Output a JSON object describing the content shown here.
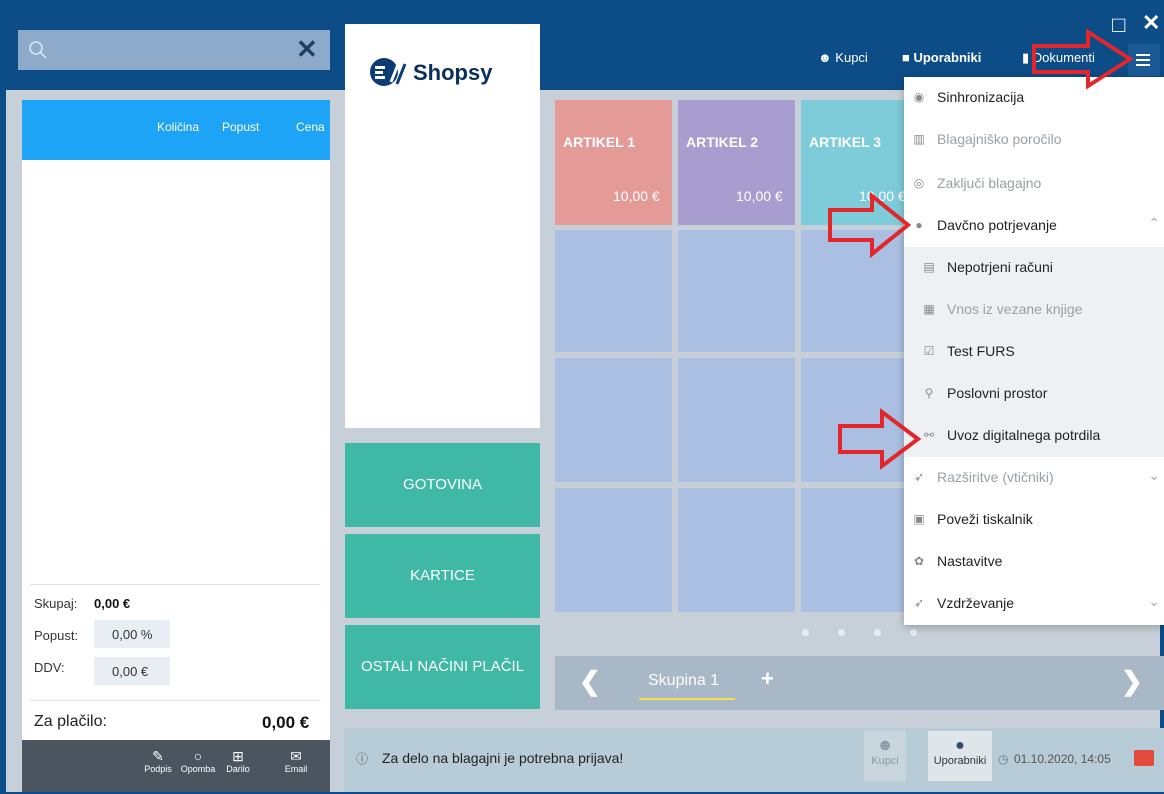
{
  "window": {
    "maximize_icon": "□",
    "close_icon": "✕"
  },
  "search": {
    "placeholder": "",
    "clear_icon": "✕"
  },
  "cart": {
    "col_qty": "Količina",
    "col_discount": "Popust",
    "col_price": "Cena"
  },
  "totals": {
    "subtotal_label": "Skupaj:",
    "subtotal_value": "0,00 €",
    "discount_label": "Popust:",
    "discount_value": "0,00 %",
    "vat_label": "DDV:",
    "vat_value": "0,00 €",
    "pay_label": "Za plačilo:",
    "pay_value": "0,00 €"
  },
  "bottom_actions": [
    "Podpis",
    "Opomba",
    "Darilo",
    "Email"
  ],
  "brand": {
    "name": "Shopsy"
  },
  "payment": {
    "cash": "GOTOVINA",
    "cards": "KARTICE",
    "other": "OSTALI NAČINI PLAČIL"
  },
  "articles": [
    {
      "name": "ARTIKEL 1",
      "price": "10,00 €",
      "color": "#e49b98"
    },
    {
      "name": "ARTIKEL 2",
      "price": "10,00 €",
      "color": "#a89dcf"
    },
    {
      "name": "ARTIKEL 3",
      "price": "10,00 €",
      "color": "#7ecbd9"
    }
  ],
  "group": {
    "label": "Skupina 1",
    "add": "+"
  },
  "status": {
    "message": "Za delo na blagajni je potrebna prijava!",
    "customers": "Kupci",
    "users": "Uporabniki",
    "datetime": "01.10.2020, 14:05"
  },
  "topnav": {
    "customers": "Kupci",
    "users": "Uporabniki",
    "documents": "Dokumenti"
  },
  "menu": [
    {
      "label": "Sinhronizacija",
      "disabled": false
    },
    {
      "label": "Blagajniško poročilo",
      "disabled": true
    },
    {
      "label": "Zaključi blagajno",
      "disabled": true
    },
    {
      "label": "Davčno potrjevanje",
      "disabled": false
    },
    {
      "label": "Nepotrjeni računi",
      "disabled": false
    },
    {
      "label": "Vnos iz vezane knjige",
      "disabled": true
    },
    {
      "label": "Test FURS",
      "disabled": false
    },
    {
      "label": "Poslovni prostor",
      "disabled": false
    },
    {
      "label": "Uvoz digitalnega potrdila",
      "disabled": false
    },
    {
      "label": "Razširitve (vtičniki)",
      "disabled": true
    },
    {
      "label": "Poveži tiskalnik",
      "disabled": false
    },
    {
      "label": "Nastavitve",
      "disabled": false
    },
    {
      "label": "Vzdrževanje",
      "disabled": false
    }
  ],
  "colors": {
    "accent": "#1ea4f7",
    "header": "#0c4d88",
    "payment": "#3fb8a6",
    "annotation_arrow": "#e3262b"
  }
}
